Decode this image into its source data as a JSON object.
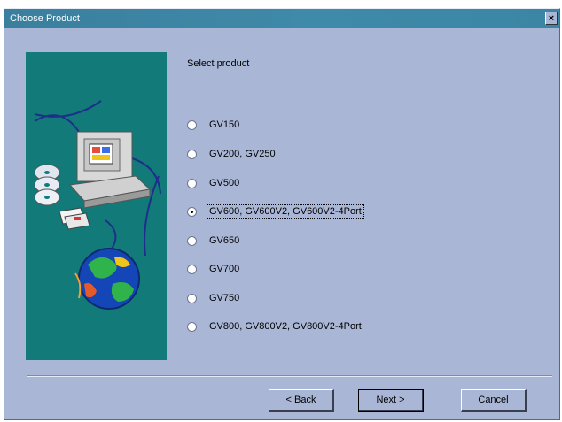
{
  "window": {
    "title": "Choose Product",
    "close_glyph": "×"
  },
  "prompt": "Select product",
  "options": [
    {
      "label": "GV150",
      "checked": false
    },
    {
      "label": "GV200, GV250",
      "checked": false
    },
    {
      "label": "GV500",
      "checked": false
    },
    {
      "label": "GV600, GV600V2, GV600V2-4Port",
      "checked": true
    },
    {
      "label": "GV650",
      "checked": false
    },
    {
      "label": "GV700",
      "checked": false
    },
    {
      "label": "GV750",
      "checked": false
    },
    {
      "label": "GV800, GV800V2, GV800V2-4Port",
      "checked": false
    }
  ],
  "buttons": {
    "back": "< Back",
    "next": "Next >",
    "cancel": "Cancel"
  },
  "icons": {
    "illustration": "computer-cd-globe-illustration",
    "close": "close-icon"
  },
  "colors": {
    "titlebar": "#3f8aa8",
    "dialog_bg": "#a9b6d6",
    "art_bg": "#127a78"
  }
}
